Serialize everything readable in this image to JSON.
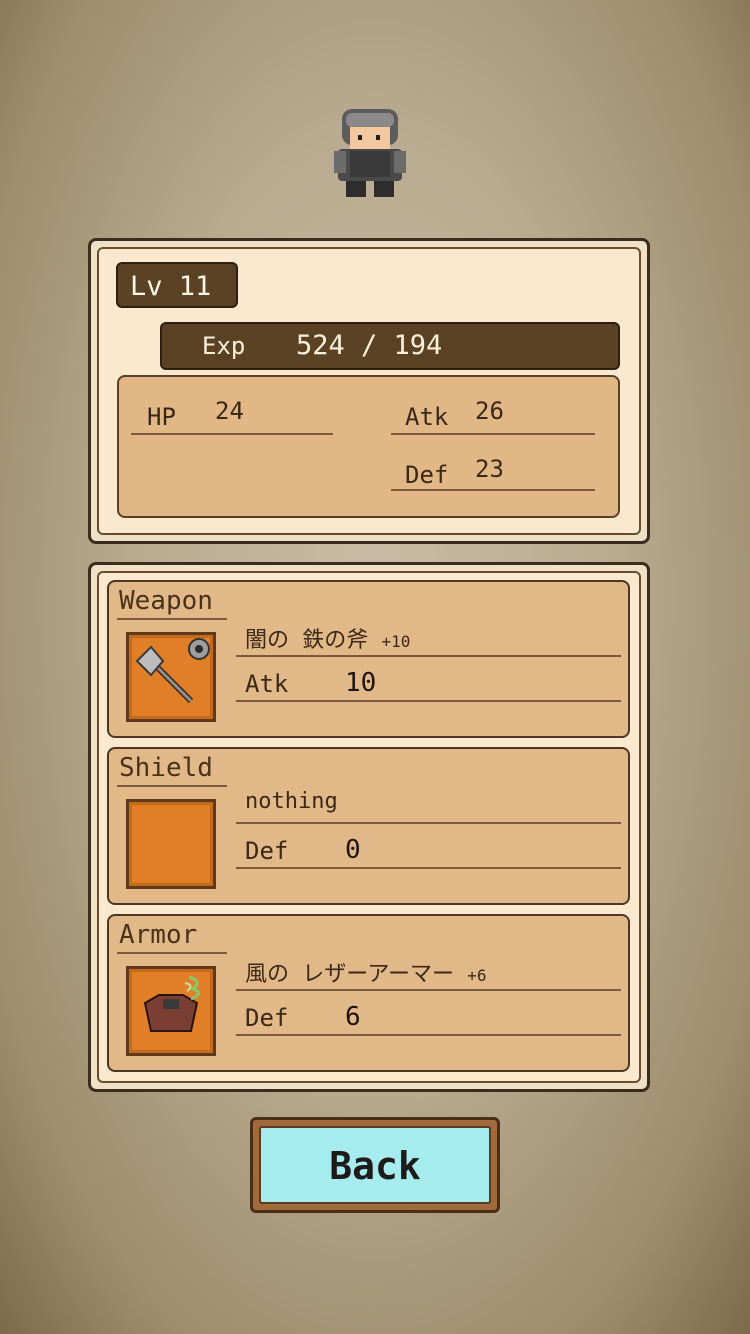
{
  "player": {
    "level_label": "Lv 11",
    "exp_label": "Exp",
    "exp_value": "524 / 194",
    "stats": {
      "hp_label": "HP",
      "hp_value": "24",
      "atk_label": "Atk",
      "atk_value": "26",
      "def_label": "Def",
      "def_value": "23"
    }
  },
  "equipment": {
    "weapon": {
      "title": "Weapon",
      "name": "闇の 鉄の斧",
      "plus": "+10",
      "stat_label": "Atk",
      "stat_value": "10"
    },
    "shield": {
      "title": "Shield",
      "name": "nothing",
      "plus": "",
      "stat_label": "Def",
      "stat_value": "0"
    },
    "armor": {
      "title": "Armor",
      "name": "風の レザーアーマー",
      "plus": "+6",
      "stat_label": "Def",
      "stat_value": "6"
    }
  },
  "back_button": {
    "label": "Back"
  },
  "colors": {
    "panel_dark": "#5c4224",
    "slot_bg": "#e1b887",
    "icon_bg": "#e07f28",
    "button": "#a6ecee"
  }
}
